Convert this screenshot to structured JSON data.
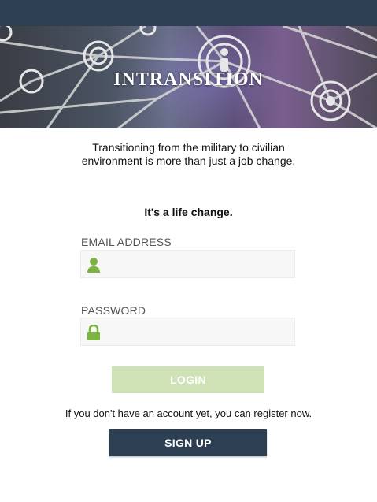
{
  "header": {
    "brand_title": "INTRANSITION"
  },
  "intro": {
    "text": "Transitioning from the military to civilian environment is more than just a job change.",
    "tagline": "It's a life change."
  },
  "form": {
    "email_label": "EMAIL ADDRESS",
    "email_value": "",
    "email_icon": "user-icon",
    "password_label": "PASSWORD",
    "password_value": "",
    "password_icon": "lock-icon",
    "login_label": "LOGIN"
  },
  "register": {
    "text": "If you don't have an account yet, you can register now.",
    "signup_label": "SIGN UP"
  },
  "colors": {
    "topbar": "#2d3f52",
    "accent_green": "#7cb342",
    "login_disabled": "#cfe2b6",
    "signup": "#2d3f52"
  }
}
